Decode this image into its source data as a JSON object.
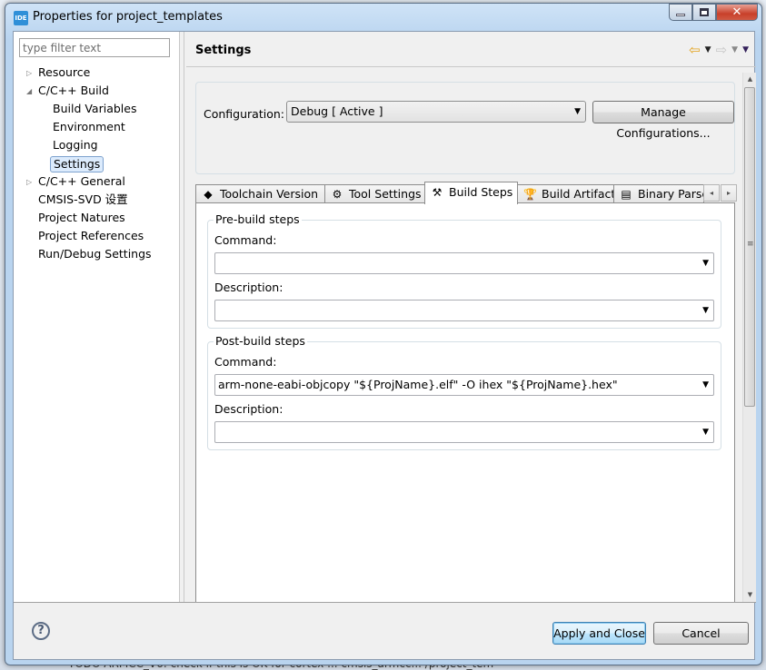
{
  "window": {
    "title": "Properties for project_templates",
    "app_icon_label": "IDE",
    "minimize_icon": "minimize-icon",
    "maximize_icon": "maximize-icon",
    "close_glyph": "✕"
  },
  "background": {
    "partial_text": "TODO ARMCC_V6: check if this is OK for cortex ...    cmsis_armcc...   /project_tem"
  },
  "sidebar": {
    "filter_placeholder": "type filter text",
    "filter_value": "",
    "items": [
      {
        "label": "Resource",
        "level": 0,
        "expander": "collapsed"
      },
      {
        "label": "C/C++ Build",
        "level": 0,
        "expander": "expanded"
      },
      {
        "label": "Build Variables",
        "level": 1
      },
      {
        "label": "Environment",
        "level": 1
      },
      {
        "label": "Logging",
        "level": 1
      },
      {
        "label": "Settings",
        "level": 1,
        "selected": true
      },
      {
        "label": "C/C++ General",
        "level": 0,
        "expander": "collapsed"
      },
      {
        "label": "CMSIS-SVD 设置",
        "level": 0
      },
      {
        "label": "Project Natures",
        "level": 0
      },
      {
        "label": "Project References",
        "level": 0
      },
      {
        "label": "Run/Debug Settings",
        "level": 0
      }
    ]
  },
  "header": {
    "title": "Settings",
    "nav": {
      "back_icon": "back-arrow-icon",
      "forward_icon": "forward-arrow-icon",
      "dropdown_glyph": "▼",
      "back_glyph": "⇦",
      "forward_glyph": "⇨"
    }
  },
  "configuration": {
    "label": "Configuration:",
    "selected": "Debug  [ Active ]",
    "manage_button": "Manage Configurations..."
  },
  "tabs": [
    {
      "label": "Toolchain  Version",
      "icon": "chip-icon",
      "glyph": "◆",
      "active": false
    },
    {
      "label": "Tool Settings",
      "icon": "tool-settings-icon",
      "glyph": "⚙",
      "active": false
    },
    {
      "label": "Build Steps",
      "icon": "build-steps-icon",
      "glyph": "⚒",
      "active": true
    },
    {
      "label": "Build Artifact",
      "icon": "build-artifact-icon",
      "glyph": "🏆",
      "active": false
    },
    {
      "label": "Binary Parse",
      "icon": "binary-parser-icon",
      "glyph": "▤",
      "active": false
    }
  ],
  "tab_scroll": {
    "left": "◂",
    "right": "▸"
  },
  "pre_build": {
    "title": "Pre-build steps",
    "command_label": "Command:",
    "command_value": "",
    "description_label": "Description:",
    "description_value": ""
  },
  "post_build": {
    "title": "Post-build steps",
    "command_label": "Command:",
    "command_value": "arm-none-eabi-objcopy \"${ProjName}.elf\" -O ihex \"${ProjName}.hex\"",
    "description_label": "Description:",
    "description_value": ""
  },
  "footer": {
    "help_glyph": "?",
    "apply_close": "Apply and Close",
    "cancel": "Cancel"
  },
  "glyphs": {
    "dropdown": "▼",
    "tree_collapsed": "▷",
    "tree_expanded": "◢",
    "scroll_up": "▲",
    "scroll_down": "▼",
    "grip": "≡"
  }
}
